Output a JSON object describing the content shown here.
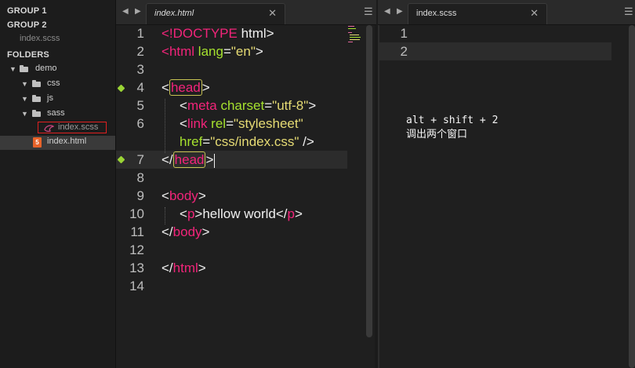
{
  "sidebar": {
    "groups": [
      "GROUP 1",
      "GROUP 2"
    ],
    "group2_open_file": "index.scss",
    "folders_label": "FOLDERS",
    "tree": {
      "root": "demo",
      "children": [
        "css",
        "js",
        "sass"
      ],
      "sass_file": "index.scss",
      "root_file": "index.html"
    }
  },
  "pane_left": {
    "tab_label": "index.html",
    "close_glyph": "✕",
    "line_numbers": [
      "1",
      "2",
      "3",
      "4",
      "5",
      "6",
      "",
      "7",
      "8",
      "9",
      "10",
      "11",
      "12",
      "13",
      "14"
    ]
  },
  "pane_right": {
    "tab_label": "index.scss",
    "close_glyph": "✕",
    "line_numbers": [
      "1",
      "2"
    ],
    "note_shortcut": "alt + shift + 2",
    "note_desc": "调出两个窗口"
  },
  "code": {
    "l1_open": "<!",
    "l1_doctype": "DOCTYPE",
    "l1_rest": " html>",
    "l2_open": "<",
    "l2_tag": "html",
    "l2_attr": " lang",
    "l2_eq": "=",
    "l2_val": "\"en\"",
    "l2_close": ">",
    "l4_open": "<",
    "l4_tag": "head",
    "l4_close": ">",
    "l5_open": "<",
    "l5_tag": "meta",
    "l5_attr": " charset",
    "l5_eq": "=",
    "l5_val": "\"utf-8\"",
    "l5_close": ">",
    "l6_open": "<",
    "l6_tag": "link",
    "l6_attr": " rel",
    "l6_eq": "=",
    "l6_val": "\"stylesheet\"",
    "l6b_attr": "href",
    "l6b_eq": "=",
    "l6b_val": "\"css/index.css\"",
    "l6b_close": " />",
    "l7_open": "</",
    "l7_tag": "head",
    "l7_close": ">",
    "l9_open": "<",
    "l9_tag": "body",
    "l9_close": ">",
    "l10_open": "<",
    "l10_tag": "p",
    "l10_mid": ">hellow world</",
    "l10_tag2": "p",
    "l10_close": ">",
    "l11_open": "</",
    "l11_tag": "body",
    "l11_close": ">",
    "l13_open": "</",
    "l13_tag": "html",
    "l13_close": ">"
  },
  "colors": {
    "tag": "#f2247a",
    "attr": "#a6e22e",
    "string": "#e6db74",
    "bookmark": "#9ad435",
    "highlight_box": "#e02020",
    "html_icon": "#e8632a"
  }
}
